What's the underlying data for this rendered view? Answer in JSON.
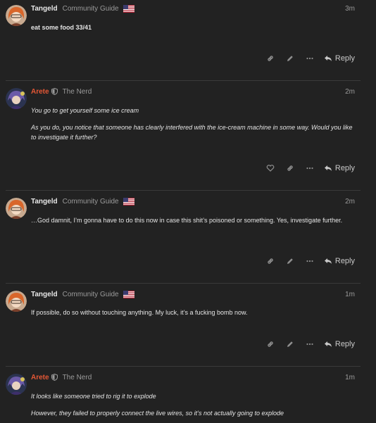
{
  "posts": [
    {
      "username": "Tangeld",
      "user_title": "Community Guide",
      "time": "3m",
      "flag": "us-flag",
      "paragraphs": [
        "eat some food 33/41"
      ],
      "reply_label": "Reply"
    },
    {
      "username": "Arete",
      "user_title": "The Nerd",
      "time": "2m",
      "paragraphs": [
        "You go to get yourself some ice cream",
        "As you do, you notice that someone has clearly interfered with the ice-cream machine in some way. Would you like to investigate it further?"
      ],
      "reply_label": "Reply"
    },
    {
      "username": "Tangeld",
      "user_title": "Community Guide",
      "time": "2m",
      "flag": "us-flag",
      "paragraphs": [
        "…God damnit, I’m gonna have to do this now in case this shit’s poisoned or something. Yes, investigate further."
      ],
      "reply_label": "Reply"
    },
    {
      "username": "Tangeld",
      "user_title": "Community Guide",
      "time": "1m",
      "flag": "us-flag",
      "paragraphs": [
        "If possible, do so without touching anything. My luck, it’s a fucking bomb now."
      ],
      "reply_label": "Reply"
    },
    {
      "username": "Arete",
      "user_title": "The Nerd",
      "time": "1m",
      "paragraphs": [
        "It looks like someone tried to rig it to explode",
        "However, they failed to properly connect the live wires, so it’s not actually going to explode"
      ]
    }
  ],
  "colors": {
    "background": "#222222",
    "staff_username": "#e45735",
    "muted": "#9a9a9a",
    "divider": "#3a3a3a"
  },
  "icons": {
    "link": "link-icon",
    "edit": "pencil-icon",
    "more": "ellipsis-icon",
    "like": "heart-icon",
    "reply": "reply-arrow-icon",
    "moderator": "shield-icon"
  }
}
